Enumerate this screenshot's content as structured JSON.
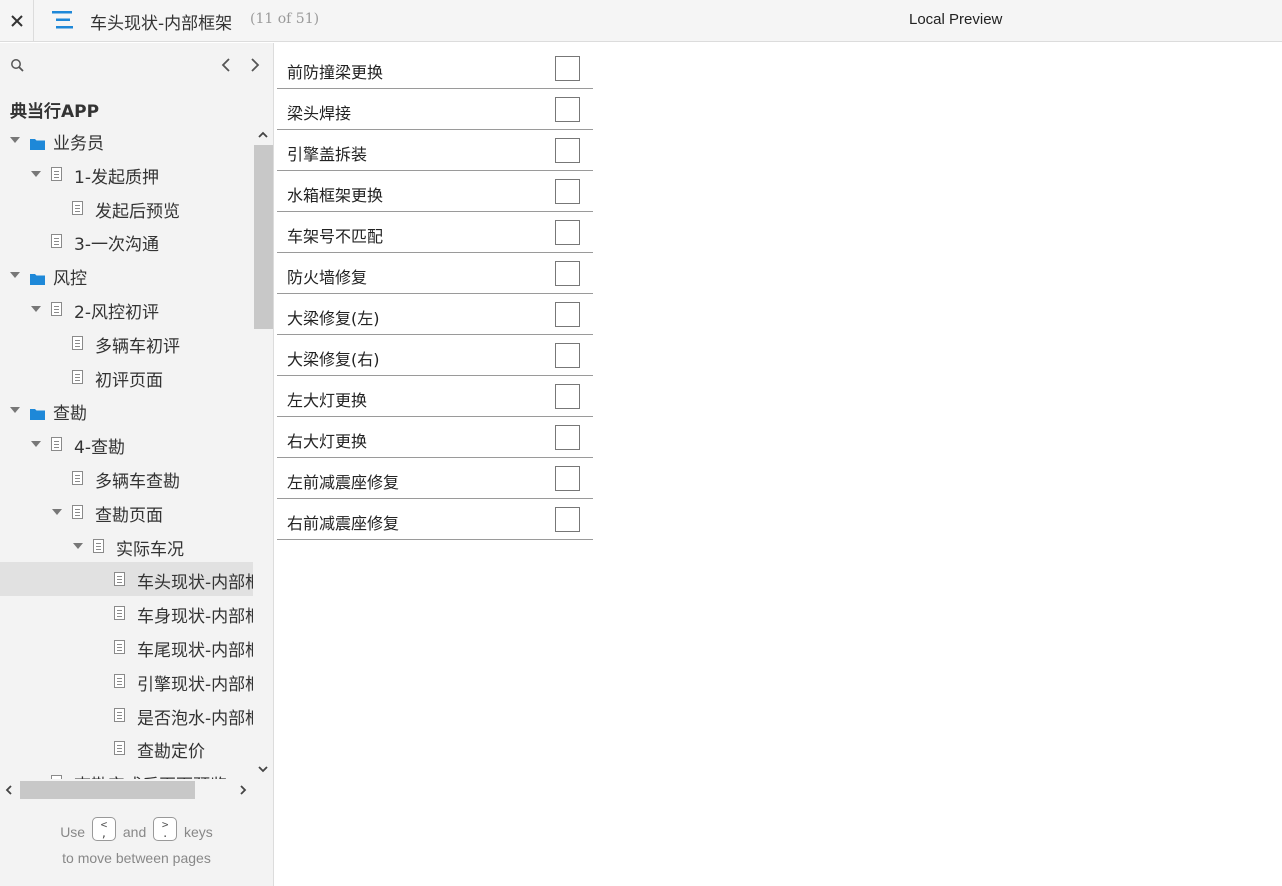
{
  "topbar": {
    "title": "车头现状-内部框架",
    "page_count": "(11 of 51)",
    "preview_label": "Local Preview"
  },
  "sidebar": {
    "project_name": "典当行APP",
    "search_placeholder": "",
    "tree": [
      {
        "label": "业务员",
        "type": "folder",
        "level": 0,
        "expanded": true
      },
      {
        "label": "1-发起质押",
        "type": "page",
        "level": 1,
        "expanded": true
      },
      {
        "label": "发起后预览",
        "type": "page",
        "level": 2
      },
      {
        "label": "3-一次沟通",
        "type": "page",
        "level": 1
      },
      {
        "label": "风控",
        "type": "folder",
        "level": 0,
        "expanded": true
      },
      {
        "label": "2-风控初评",
        "type": "page",
        "level": 1,
        "expanded": true
      },
      {
        "label": "多辆车初评",
        "type": "page",
        "level": 2
      },
      {
        "label": "初评页面",
        "type": "page",
        "level": 2
      },
      {
        "label": "查勘",
        "type": "folder",
        "level": 0,
        "expanded": true
      },
      {
        "label": "4-查勘",
        "type": "page",
        "level": 1,
        "expanded": true
      },
      {
        "label": "多辆车查勘",
        "type": "page",
        "level": 2
      },
      {
        "label": "查勘页面",
        "type": "page",
        "level": 2,
        "expanded": true
      },
      {
        "label": "实际车况",
        "type": "page",
        "level": 3,
        "expanded": true
      },
      {
        "label": "车头现状-内部框架",
        "type": "page",
        "level": 4,
        "selected": true
      },
      {
        "label": "车身现状-内部框架",
        "type": "page",
        "level": 4
      },
      {
        "label": "车尾现状-内部框架",
        "type": "page",
        "level": 4
      },
      {
        "label": "引擎现状-内部框架",
        "type": "page",
        "level": 4
      },
      {
        "label": "是否泡水-内部框架",
        "type": "page",
        "level": 4
      },
      {
        "label": "查勘定价",
        "type": "page",
        "level": 4
      },
      {
        "label": "查勘完成后页面预览",
        "type": "page",
        "level": 1
      }
    ],
    "hint": {
      "use": "Use",
      "prev_key": "<\n,",
      "and": "and",
      "next_key": ">\n.",
      "keys": "keys",
      "line2": "to move between pages"
    }
  },
  "checklist": [
    {
      "label": "前防撞梁更换",
      "checked": false
    },
    {
      "label": "梁头焊接",
      "checked": false
    },
    {
      "label": "引擎盖拆装",
      "checked": false
    },
    {
      "label": "水箱框架更换",
      "checked": false
    },
    {
      "label": "车架号不匹配",
      "checked": false
    },
    {
      "label": "防火墙修复",
      "checked": false
    },
    {
      "label": "大梁修复(左)",
      "checked": false
    },
    {
      "label": "大梁修复(右)",
      "checked": false
    },
    {
      "label": "左大灯更换",
      "checked": false
    },
    {
      "label": "右大灯更换",
      "checked": false
    },
    {
      "label": "左前减震座修复",
      "checked": false
    },
    {
      "label": "右前减震座修复",
      "checked": false
    }
  ],
  "colors": {
    "accent": "#1e88d8",
    "folder": "#1e88d8",
    "selected_row": "#e1e1e1"
  }
}
